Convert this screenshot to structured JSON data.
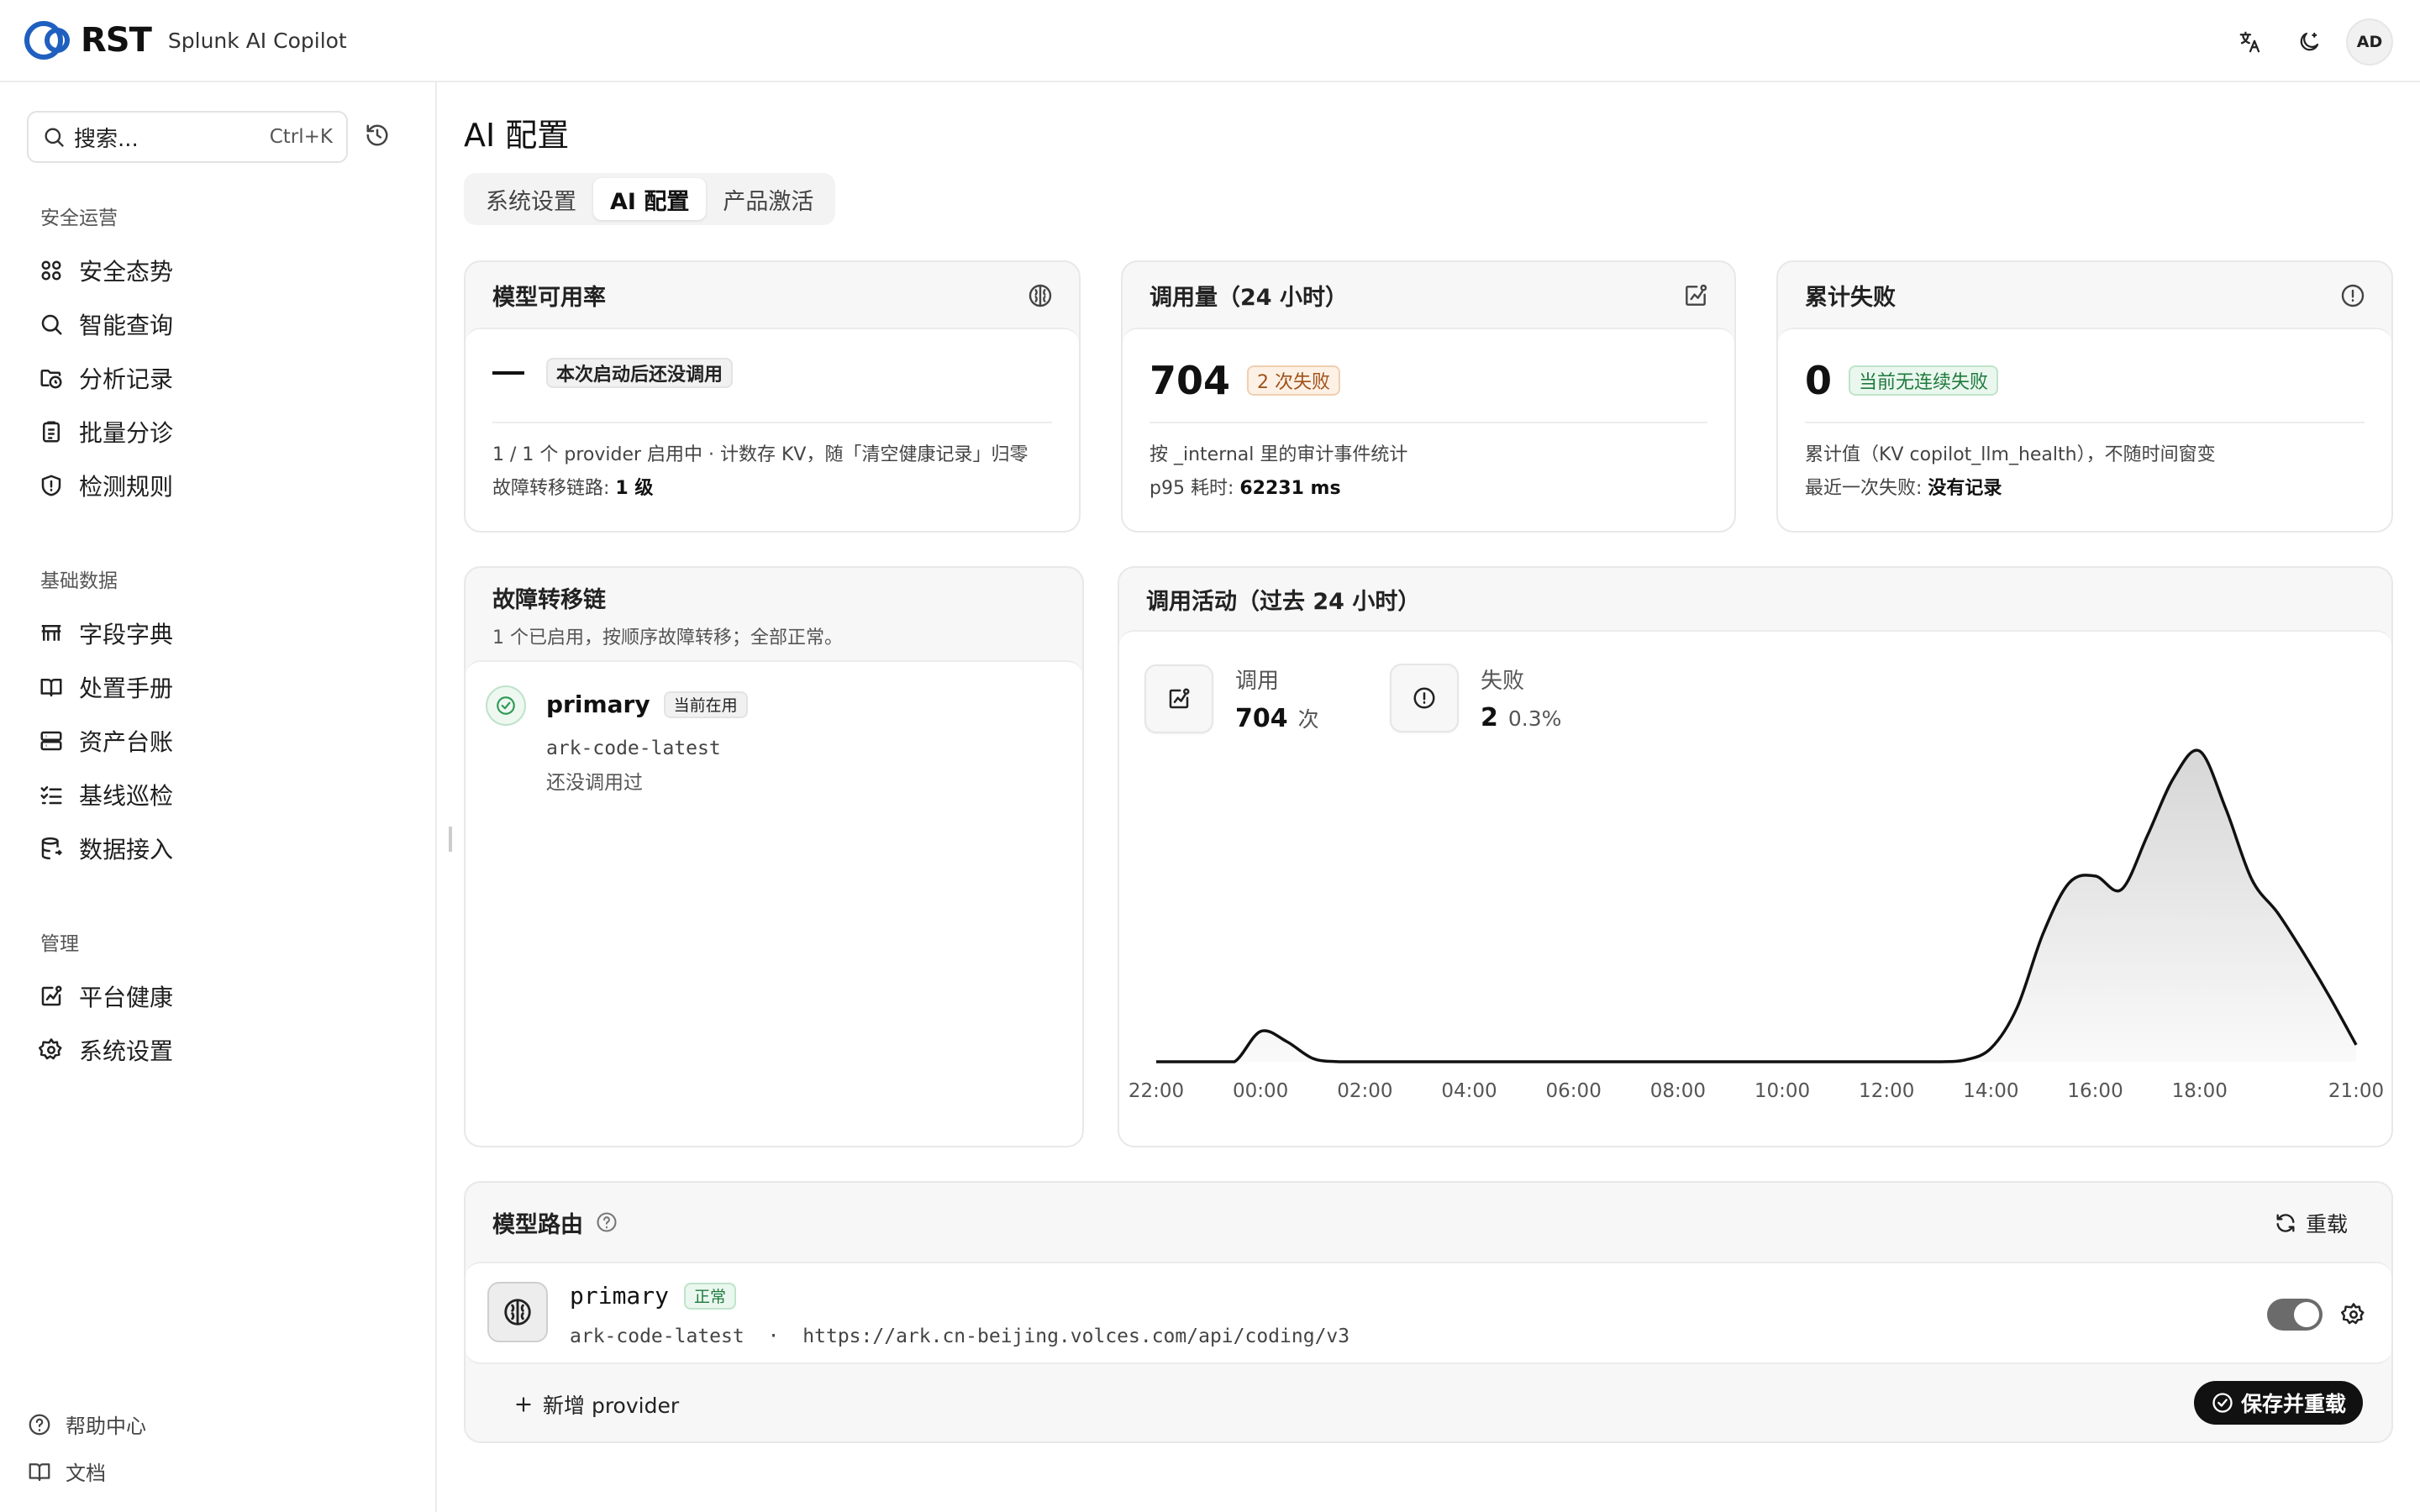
{
  "header": {
    "logo_text": "RST",
    "app_name": "Splunk AI Copilot",
    "avatar": "AD",
    "icons": [
      "translate-icon",
      "theme-moon-icon"
    ]
  },
  "sidebar": {
    "search_placeholder": "搜索...",
    "search_shortcut": "Ctrl+K",
    "groups": [
      {
        "title": "安全运营",
        "items": [
          "安全态势",
          "智能查询",
          "分析记录",
          "批量分诊",
          "检测规则"
        ]
      },
      {
        "title": "基础数据",
        "items": [
          "字段字典",
          "处置手册",
          "资产台账",
          "基线巡检",
          "数据接入"
        ]
      },
      {
        "title": "管理",
        "items": [
          "平台健康",
          "系统设置"
        ]
      }
    ],
    "footer": [
      "帮助中心",
      "文档"
    ]
  },
  "main": {
    "title": "AI 配置",
    "tabs": [
      {
        "label": "系统设置",
        "active": false
      },
      {
        "label": "AI 配置",
        "active": true
      },
      {
        "label": "产品激活",
        "active": false
      }
    ],
    "cards": {
      "availability": {
        "title": "模型可用率",
        "badge": "本次启动后还没调用",
        "desc_line1": "1 / 1 个 provider 启用中 · 计数存 KV，随「清空健康记录」归零",
        "desc_line2_label": "故障转移链路: ",
        "desc_line2_value": "1 级"
      },
      "calls": {
        "title": "调用量（24 小时）",
        "value": "704",
        "badge": "2 次失败",
        "desc_line1": "按 _internal 里的审计事件统计",
        "desc_line2_label": "p95 耗时: ",
        "desc_line2_value": "62231 ms"
      },
      "failures": {
        "title": "累计失败",
        "value": "0",
        "badge": "当前无连续失败",
        "desc_line1": "累计值（KV copilot_llm_health），不随时间窗变",
        "desc_line2_label": "最近一次失败: ",
        "desc_line2_value": "没有记录"
      }
    },
    "failover": {
      "title": "故障转移链",
      "subtitle": "1 个已启用，按顺序故障转移；全部正常。",
      "provider": {
        "name": "primary",
        "badge": "当前在用",
        "model": "ark-code-latest",
        "note": "还没调用过"
      }
    },
    "activity": {
      "title": "调用活动（过去 24 小时）",
      "calls_label": "调用",
      "calls_value": "704",
      "calls_unit": "次",
      "fail_label": "失败",
      "fail_value": "2",
      "fail_pct": "0.3%"
    },
    "routing": {
      "title": "模型路由",
      "reload_label": "重载",
      "route": {
        "name": "primary",
        "badge": "正常",
        "model": "ark-code-latest",
        "separator": "·",
        "url": "https://ark.cn-beijing.volces.com/api/coding/v3",
        "enabled": true
      },
      "add_label": "新增 provider",
      "save_label": "保存并重载"
    }
  },
  "chart_data": {
    "type": "area",
    "x": [
      "22:00",
      "22:30",
      "23:00",
      "23:30",
      "00:00",
      "00:30",
      "01:00",
      "01:30",
      "02:00",
      "03:00",
      "04:00",
      "05:00",
      "06:00",
      "07:00",
      "08:00",
      "09:00",
      "10:00",
      "11:00",
      "12:00",
      "13:00",
      "13:30",
      "14:00",
      "14:30",
      "15:00",
      "15:30",
      "16:00",
      "16:30",
      "17:00",
      "17:30",
      "18:00",
      "18:30",
      "19:00",
      "19:30",
      "20:00",
      "20:30",
      "21:00"
    ],
    "values": [
      0,
      0,
      0,
      0,
      9,
      6,
      1,
      0,
      0,
      0,
      0,
      0,
      0,
      0,
      0,
      0,
      0,
      0,
      0,
      0,
      0.5,
      4,
      16,
      38,
      53,
      55,
      51,
      67,
      84,
      92,
      75,
      54,
      44,
      32,
      19,
      5
    ],
    "xticks": [
      "22:00",
      "00:00",
      "02:00",
      "04:00",
      "06:00",
      "08:00",
      "10:00",
      "12:00",
      "14:00",
      "16:00",
      "18:00",
      "21:00"
    ],
    "grid": false,
    "color": "#111111"
  }
}
